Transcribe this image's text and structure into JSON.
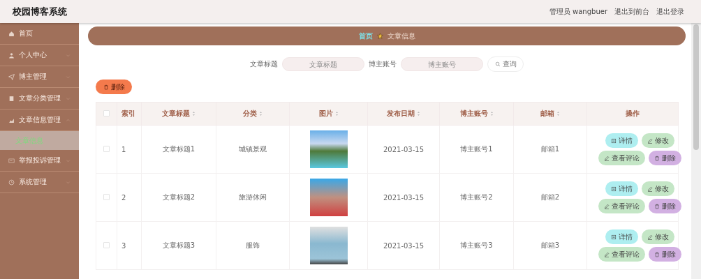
{
  "header": {
    "title": "校园博客系统",
    "user": "管理员 wangbuer",
    "links": [
      "退出到前台",
      "退出登录"
    ]
  },
  "sidebar": {
    "items": [
      {
        "label": "首页",
        "kind": "link"
      },
      {
        "label": "个人中心",
        "kind": "menu"
      },
      {
        "label": "博主管理",
        "kind": "menu"
      },
      {
        "label": "文章分类管理",
        "kind": "menu"
      },
      {
        "label": "文章信息管理",
        "kind": "menu",
        "children": [
          {
            "label": "文章信息",
            "selected": true
          }
        ]
      },
      {
        "label": "举报投诉管理",
        "kind": "menu"
      },
      {
        "label": "系统管理",
        "kind": "menu"
      }
    ]
  },
  "breadcrumb": [
    "首页",
    "文章信息"
  ],
  "search": {
    "fields": [
      {
        "label": "文章标题",
        "placeholder": "文章标题"
      },
      {
        "label": "博主账号",
        "placeholder": "博主账号"
      }
    ],
    "button": "查询"
  },
  "delete_button": "删除",
  "table": {
    "all_checked": false,
    "columns": [
      {
        "label": "索引",
        "sortable": false
      },
      {
        "label": "文章标题",
        "sortable": true
      },
      {
        "label": "分类",
        "sortable": true
      },
      {
        "label": "图片",
        "sortable": true
      },
      {
        "label": "发布日期",
        "sortable": true
      },
      {
        "label": "博主账号",
        "sortable": true
      },
      {
        "label": "邮箱",
        "sortable": true
      },
      {
        "label": "操作",
        "sortable": false
      }
    ],
    "rows": [
      {
        "checked": false,
        "index": "1",
        "title": "文章标题1",
        "category": "城镇景观",
        "date": "2021-03-15",
        "account": "博主账号1",
        "email": "邮箱1",
        "actions": [
          "详情",
          "修改",
          "查看评论",
          "删除"
        ]
      },
      {
        "checked": false,
        "index": "2",
        "title": "文章标题2",
        "category": "旅游休闲",
        "date": "2021-03-15",
        "account": "博主账号2",
        "email": "邮箱2",
        "actions": [
          "详情",
          "修改",
          "查看评论",
          "删除"
        ]
      },
      {
        "checked": false,
        "index": "3",
        "title": "文章标题3",
        "category": "服饰",
        "date": "2021-03-15",
        "account": "博主账号3",
        "email": "邮箱3",
        "actions": [
          "详情",
          "修改",
          "查看评论",
          "删除"
        ]
      }
    ]
  }
}
